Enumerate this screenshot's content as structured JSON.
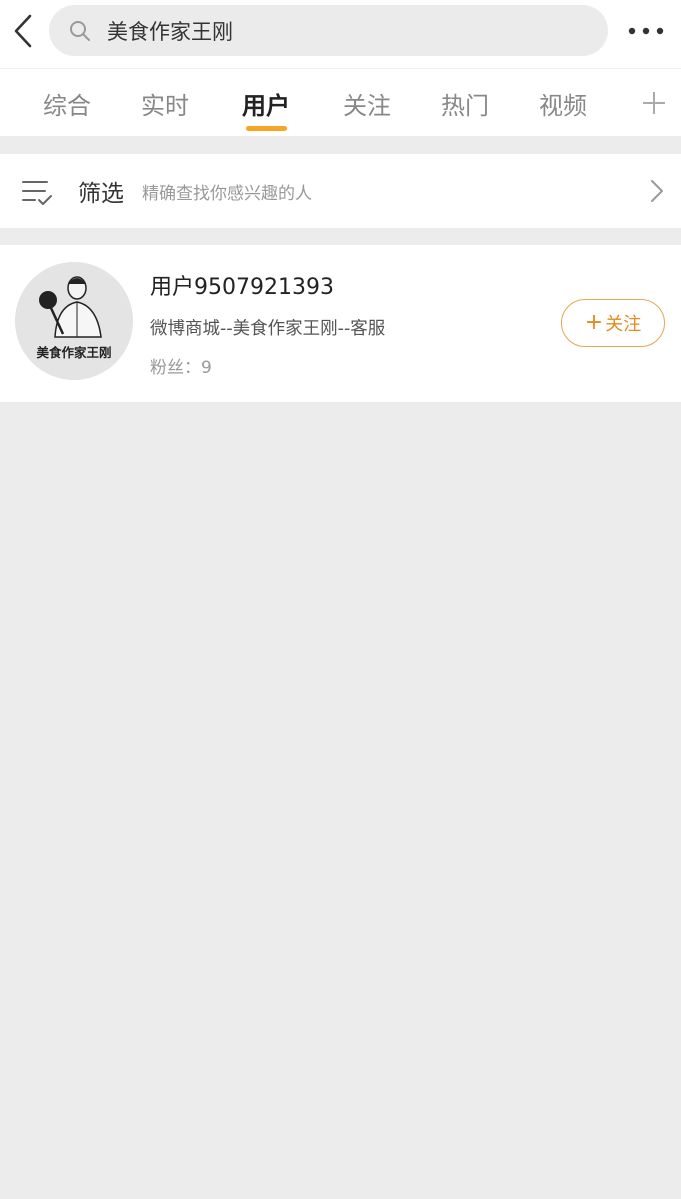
{
  "search": {
    "query": "美食作家王刚"
  },
  "tabs": [
    {
      "label": "综合"
    },
    {
      "label": "实时"
    },
    {
      "label": "用户"
    },
    {
      "label": "关注"
    },
    {
      "label": "热门"
    },
    {
      "label": "视频"
    }
  ],
  "active_tab": "用户",
  "filter": {
    "title": "筛选",
    "description": "精确查找你感兴趣的人"
  },
  "user": {
    "name": "用户9507921393",
    "description": "微博商城--美食作家王刚--客服",
    "fans": "粉丝：9",
    "avatar_caption": "美食作家王刚"
  },
  "follow_button": {
    "plus": "+",
    "label": "关注"
  },
  "colors": {
    "accent": "#f5a623",
    "follow_border": "#e8a550",
    "follow_text": "#e38b1e",
    "page_bg": "#ececec"
  },
  "icons": [
    "back-arrow-icon",
    "search-icon",
    "more-icon",
    "add-tab-icon",
    "filter-icon",
    "chevron-right-icon"
  ]
}
